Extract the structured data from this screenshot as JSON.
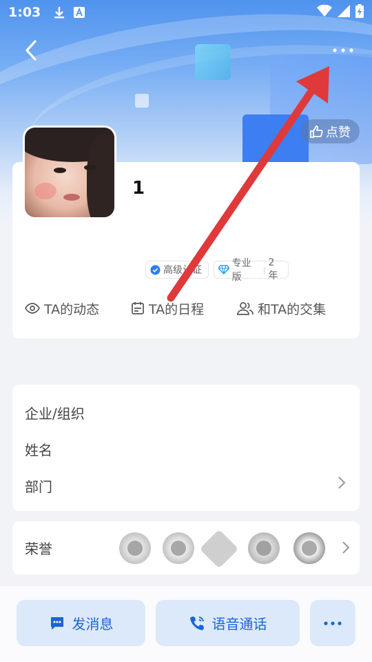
{
  "status_bar": {
    "time": "1:03"
  },
  "header": {
    "like_label": "点赞"
  },
  "profile": {
    "name": "1",
    "badges": [
      {
        "label": "高级认证",
        "icon": "verified-icon"
      },
      {
        "label": "专业版",
        "extra": "2年",
        "icon": "diamond-icon"
      }
    ],
    "tabs": [
      {
        "label": "TA的动态",
        "icon": "eye-icon"
      },
      {
        "label": "TA的日程",
        "icon": "calendar-icon"
      },
      {
        "label": "和TA的交集",
        "icon": "people-icon"
      }
    ]
  },
  "info": {
    "rows": [
      {
        "label": "企业/组织"
      },
      {
        "label": "姓名"
      },
      {
        "label": "部门"
      }
    ]
  },
  "honor": {
    "label": "荣誉",
    "medal_count": 5
  },
  "actions": {
    "message_label": "发消息",
    "call_label": "语音通话"
  },
  "colors": {
    "accent": "#1b63d8",
    "button_bg": "#dce9fa",
    "annotation_arrow": "#e0393b"
  }
}
